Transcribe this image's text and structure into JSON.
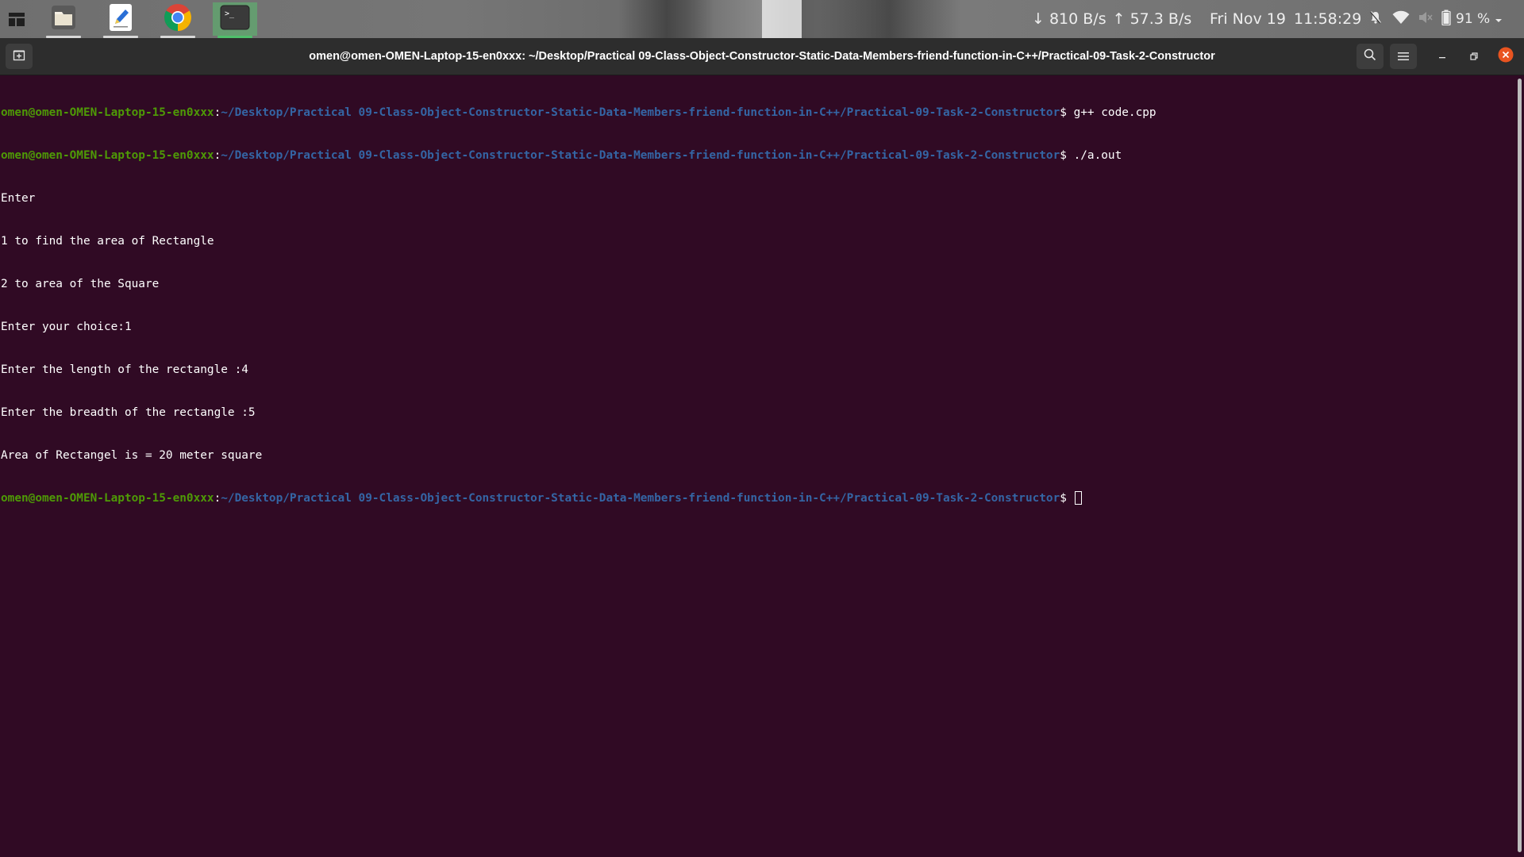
{
  "top_panel": {
    "network_down": "↓ 810 B/s",
    "network_up": "↑ 57.3 B/s",
    "date": "Fri Nov 19",
    "time": "11:58:29",
    "battery": "91 %",
    "dock_apps": [
      {
        "name": "files",
        "icon": "folder-icon"
      },
      {
        "name": "text-editor",
        "icon": "text-editor-icon"
      },
      {
        "name": "chrome",
        "icon": "chrome-icon"
      },
      {
        "name": "terminal",
        "icon": "terminal-icon",
        "active": true
      }
    ]
  },
  "window": {
    "title": "omen@omen-OMEN-Laptop-15-en0xxx: ~/Desktop/Practical 09-Class-Object-Constructor-Static-Data-Members-friend-function-in-C++/Practical-09-Task-2-Constructor"
  },
  "terminal": {
    "user_host": "omen@omen-OMEN-Laptop-15-en0xxx",
    "separator": ":",
    "path": "~/Desktop/Practical 09-Class-Object-Constructor-Static-Data-Members-friend-function-in-C++/Practical-09-Task-2-Constructor",
    "prompt_symbol": "$ ",
    "commands": [
      "g++ code.cpp",
      "./a.out"
    ],
    "output": [
      "Enter",
      "1 to find the area of Rectangle",
      "2 to area of the Square",
      "Enter your choice:1",
      "Enter the length of the rectangle :4",
      "Enter the breadth of the rectangle :5",
      "Area of Rectangel is = 20 meter square"
    ]
  },
  "colors": {
    "terminal_bg": "#300a24",
    "user_color": "#4e9a06",
    "path_color": "#3465a4",
    "titlebar_bg": "#2d2d2d",
    "close_button": "#e95420"
  }
}
